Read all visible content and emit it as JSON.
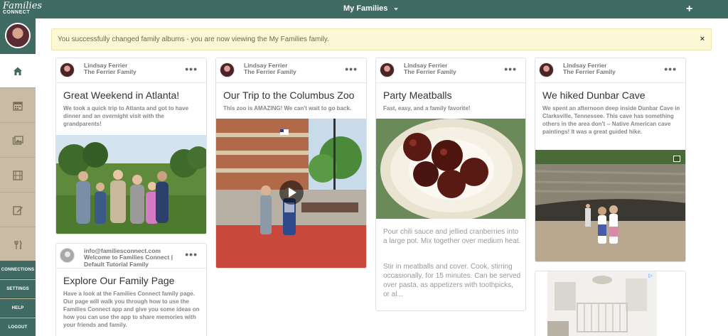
{
  "topbar": {
    "logo_line1": "Families",
    "logo_line2": "CONNECT",
    "family_name": "My Families",
    "add_icon": "+"
  },
  "sidebar": {
    "icons": [
      "home-icon",
      "calendar-icon",
      "photos-icon",
      "videos-icon",
      "notes-icon",
      "recipes-icon"
    ],
    "links": [
      "CONNECTIONS",
      "SETTINGS",
      "HELP",
      "LOGOUT"
    ]
  },
  "alert": {
    "message": "You successfully changed family albums - you are now viewing the My Families family.",
    "close": "×"
  },
  "cards": [
    {
      "author": "Lindsay Ferrier",
      "family": "The Ferrier Family",
      "more": "•••",
      "title": "Great Weekend in Atlanta!",
      "subtitle": "We took a quick trip to Atlanta and got to have dinner and an overnight visit with the grandparents!"
    },
    {
      "author": "Lindsay Ferrier",
      "family": "The Ferrier Family",
      "more": "•••",
      "title": "Our Trip to the Columbus Zoo",
      "subtitle": "This zoo is AMAZING! We can't wait to go back."
    },
    {
      "author": "Lindsay Ferrier",
      "family": "The Ferrier Family",
      "more": "•••",
      "title": "Party Meatballs",
      "subtitle": "Fast, easy, and a family favorite!",
      "body1": "Pour chili sauce and jellied cranberries into a large pot. Mix together over medium heat.",
      "body2": "Stir in  meatballs and cover.  Cook, stirring occasionally, for 15 minutes. Can be served over pasta, as appetizers with toothpicks, or al..."
    },
    {
      "author": "Lindsay Ferrier",
      "family": "The Ferrier Family",
      "more": "•••",
      "title": "We hiked Dunbar Cave",
      "subtitle": "We spent an afternoon deep inside Dunbar Cave in Clarksville, Tennessee. This cave has something others in the area don't -- Native American cave paintings! It was a great guided hike."
    },
    {
      "author": "info@familiesconnect.com",
      "family": "Welcome to Families Connect | Default Tutorial Family",
      "more": "•••",
      "title": "Explore Our Family Page",
      "subtitle": "Have a look at the Families Connect family page. Our page will walk you through how to use the Families Connect app and give you some ideas on how you can use the app to share memories with your friends and family."
    }
  ],
  "colors": {
    "topbar": "#3f6b63",
    "sidebar": "#c8bca5",
    "alert_bg": "#fcf8d5"
  }
}
